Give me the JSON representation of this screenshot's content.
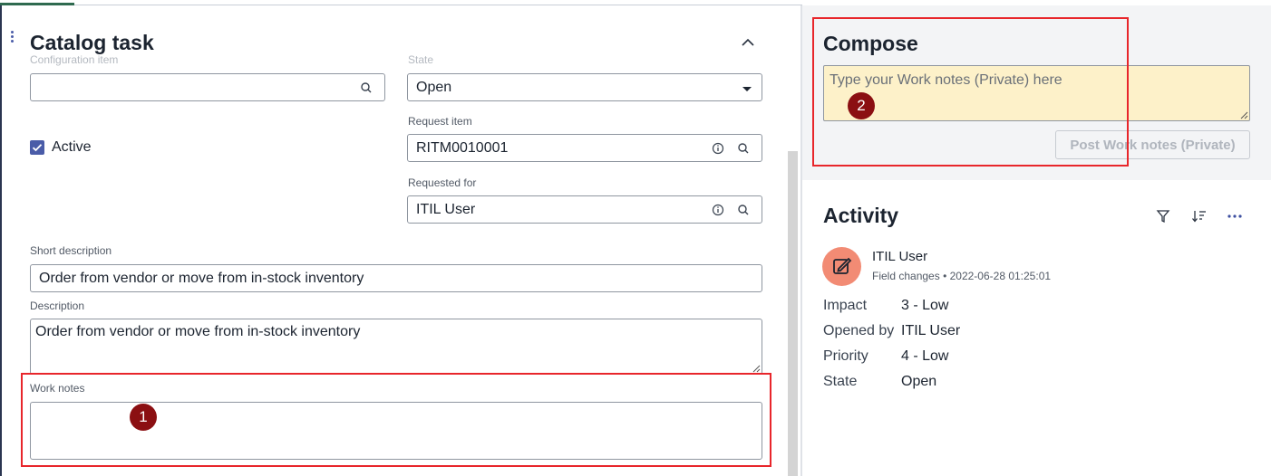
{
  "form": {
    "title": "Catalog task",
    "configuration_item": {
      "label": "Configuration item",
      "value": ""
    },
    "state": {
      "label": "State",
      "value": "Open"
    },
    "active": {
      "label": "Active",
      "checked": true
    },
    "request_item": {
      "label": "Request item",
      "value": "RITM0010001"
    },
    "requested_for": {
      "label": "Requested for",
      "value": "ITIL User"
    },
    "short_description": {
      "label": "Short description",
      "value": "Order from vendor or move from in-stock inventory"
    },
    "description": {
      "label": "Description",
      "value": "Order from vendor or move from in-stock inventory"
    },
    "work_notes": {
      "label": "Work notes",
      "value": ""
    }
  },
  "compose": {
    "title": "Compose",
    "placeholder": "Type your Work notes (Private) here",
    "post_button": "Post Work notes (Private)"
  },
  "activity": {
    "title": "Activity",
    "tools": [
      "filter-icon",
      "sort-icon",
      "more-icon"
    ],
    "entry": {
      "user": "ITIL User",
      "type": "Field changes",
      "separator": "•",
      "timestamp": "2022-06-28 01:25:01",
      "changes": [
        {
          "label": "Impact",
          "value": "3 - Low"
        },
        {
          "label": "Opened by",
          "value": "ITIL User"
        },
        {
          "label": "Priority",
          "value": "4 - Low"
        },
        {
          "label": "State",
          "value": "Open"
        }
      ]
    }
  },
  "annotations": {
    "badge_1": "1",
    "badge_2": "2",
    "highlight_color": "#e8262b",
    "badge_color": "#8b0f12"
  },
  "colors": {
    "accent": "#4a5ca8",
    "compose_input_bg": "#fdf1c9",
    "avatar_bg": "#f28b74"
  }
}
